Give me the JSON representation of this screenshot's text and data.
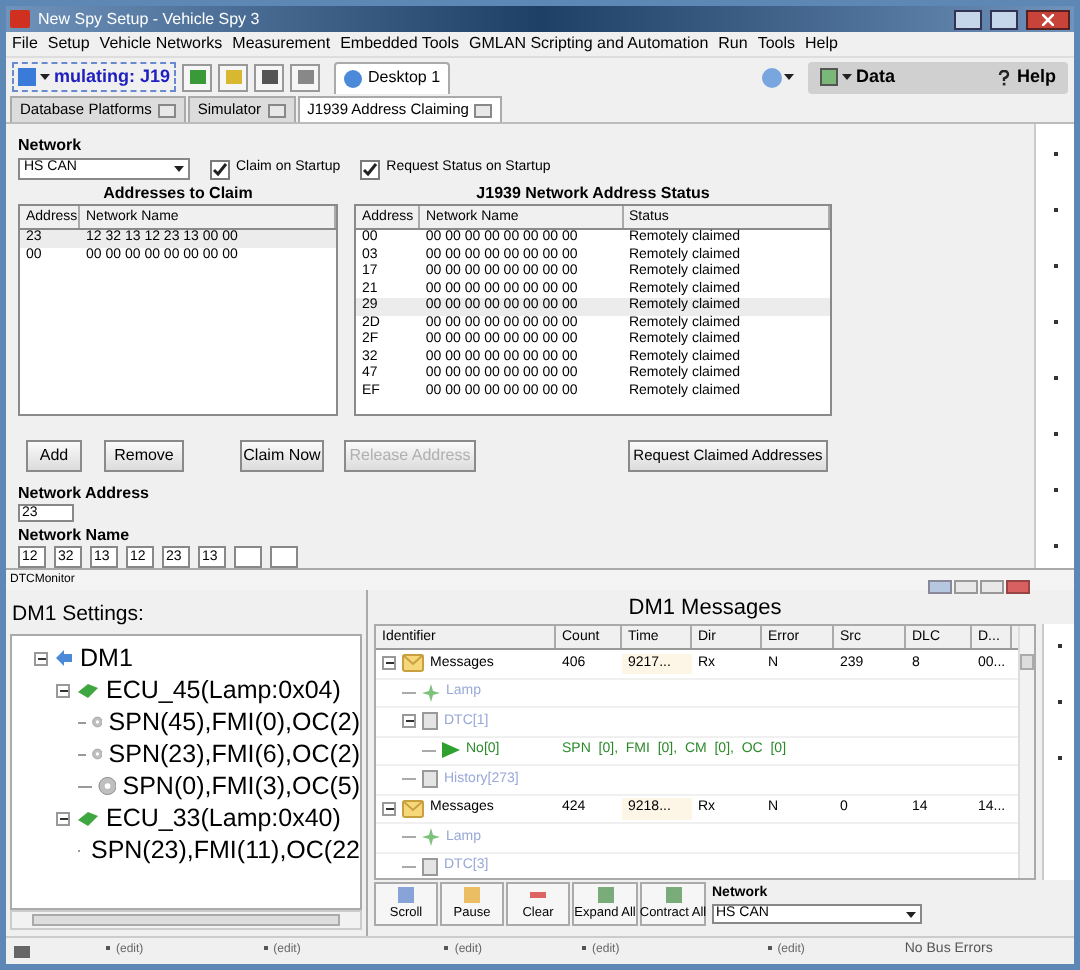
{
  "window": {
    "title": "New Spy Setup - Vehicle Spy 3"
  },
  "menu": [
    "File",
    "Setup",
    "Vehicle Networks",
    "Measurement",
    "Embedded Tools",
    "GMLAN Scripting and Automation",
    "Run",
    "Tools",
    "Help"
  ],
  "toolbar": {
    "mode_dropdown": "mulating: J19",
    "desktop_tab": "Desktop 1",
    "data_button": "Data",
    "help_button": "Help"
  },
  "tabs": [
    {
      "label": "Database Platforms",
      "selected": false
    },
    {
      "label": "Simulator",
      "selected": false
    },
    {
      "label": "J1939 Address Claiming",
      "selected": true
    }
  ],
  "address_claiming": {
    "network_label": "Network",
    "network": "HS CAN",
    "options": [
      {
        "label": "Claim on Startup",
        "checked": true
      },
      {
        "label": "Request Status on Startup",
        "checked": true
      }
    ],
    "claim_table": {
      "title": "Addresses to Claim",
      "columns": [
        "Address",
        "Network Name"
      ],
      "rows": [
        {
          "cells": [
            "23",
            "12 32 13 12 23 13 00 00"
          ],
          "selected": true
        },
        {
          "cells": [
            "00",
            "00 00 00 00 00 00 00 00"
          ],
          "selected": false
        }
      ]
    },
    "status_table": {
      "title": "J1939 Network Address Status",
      "columns": [
        "Address",
        "Network Name",
        "Status"
      ],
      "rows": [
        {
          "cells": [
            "00",
            "00 00 00 00 00 00 00 00",
            "Remotely claimed"
          ],
          "selected": false
        },
        {
          "cells": [
            "03",
            "00 00 00 00 00 00 00 00",
            "Remotely claimed"
          ],
          "selected": false
        },
        {
          "cells": [
            "17",
            "00 00 00 00 00 00 00 00",
            "Remotely claimed"
          ],
          "selected": false
        },
        {
          "cells": [
            "21",
            "00 00 00 00 00 00 00 00",
            "Remotely claimed"
          ],
          "selected": false
        },
        {
          "cells": [
            "29",
            "00 00 00 00 00 00 00 00",
            "Remotely claimed"
          ],
          "selected": true
        },
        {
          "cells": [
            "2D",
            "00 00 00 00 00 00 00 00",
            "Remotely claimed"
          ],
          "selected": false
        },
        {
          "cells": [
            "2F",
            "00 00 00 00 00 00 00 00",
            "Remotely claimed"
          ],
          "selected": false
        },
        {
          "cells": [
            "32",
            "00 00 00 00 00 00 00 00",
            "Remotely claimed"
          ],
          "selected": false
        },
        {
          "cells": [
            "47",
            "00 00 00 00 00 00 00 00",
            "Remotely claimed"
          ],
          "selected": false
        },
        {
          "cells": [
            "EF",
            "00 00 00 00 00 00 00 00",
            "Remotely claimed"
          ],
          "selected": false
        }
      ]
    },
    "buttons": [
      {
        "label": "Add",
        "disabled": false
      },
      {
        "label": "Remove",
        "disabled": false
      },
      {
        "label": "Claim Now",
        "disabled": false
      },
      {
        "label": "Release Address",
        "disabled": true
      }
    ],
    "request_button": "Request Claimed Addresses",
    "address_label": "Network Address",
    "address": "23",
    "name_label": "Network Name",
    "name_bytes": [
      {
        "kind": "byte",
        "value": "12"
      },
      {
        "kind": "byte",
        "value": "32"
      },
      {
        "kind": "byte",
        "value": "13"
      },
      {
        "kind": "byte",
        "value": "12"
      },
      {
        "kind": "byte",
        "value": "23"
      },
      {
        "kind": "byte",
        "value": "13"
      },
      {
        "kind": "blank"
      },
      {
        "kind": "blank"
      }
    ]
  },
  "dtc_monitor": {
    "title": "DTCMonitor",
    "settings_title": "DM1 Settings:",
    "tree": [
      {
        "label": "DM1",
        "kind": "root",
        "children": [
          {
            "label": "ECU_45(Lamp:0x04)",
            "kind": "ecu",
            "children": [
              {
                "label": "SPN(45),FMI(0),OC(2)",
                "kind": "code"
              },
              {
                "label": "SPN(23),FMI(6),OC(2)",
                "kind": "code"
              },
              {
                "label": "SPN(0),FMI(3),OC(5)",
                "kind": "code"
              }
            ]
          },
          {
            "label": "ECU_33(Lamp:0x40)",
            "kind": "ecu",
            "children": [
              {
                "label": "SPN(23),FMI(11),OC(22",
                "kind": "code"
              }
            ]
          }
        ]
      }
    ],
    "messages_title": "DM1 Messages",
    "identifier_column": "Identifier",
    "columns": [
      "Count",
      "Time",
      "Dir",
      "Error",
      "Src",
      "DLC",
      "D..."
    ],
    "rows": [
      {
        "label": "Messages",
        "kind": "message",
        "cells": [
          "406",
          "9217...",
          "Rx",
          "N",
          "239",
          "8",
          "00..."
        ],
        "children": [
          {
            "label": "Lamp",
            "kind": "lamp"
          },
          {
            "label": "DTC[1]",
            "kind": "dtc",
            "children": [
              {
                "label": "No[0]",
                "kind": "code",
                "detail": "SPN  [0],  FMI  [0],  CM  [0],  OC  [0]"
              }
            ]
          },
          {
            "label": "History[273]",
            "kind": "history"
          }
        ]
      },
      {
        "label": "Messages",
        "kind": "message",
        "cells": [
          "424",
          "9218...",
          "Rx",
          "N",
          "0",
          "14",
          "14..."
        ],
        "children": [
          {
            "label": "Lamp",
            "kind": "lamp"
          },
          {
            "label": "DTC[3]",
            "kind": "dtc"
          }
        ]
      }
    ],
    "controls": [
      "Scroll",
      "Pause",
      "Clear",
      "Expand All",
      "Contract All"
    ],
    "network_label": "Network",
    "network": "HS CAN"
  },
  "status_bar": {
    "fields": [
      "(edit)",
      "(edit)",
      "(edit)",
      "(edit)",
      "(edit)"
    ],
    "bus_status": "No Bus Errors"
  }
}
